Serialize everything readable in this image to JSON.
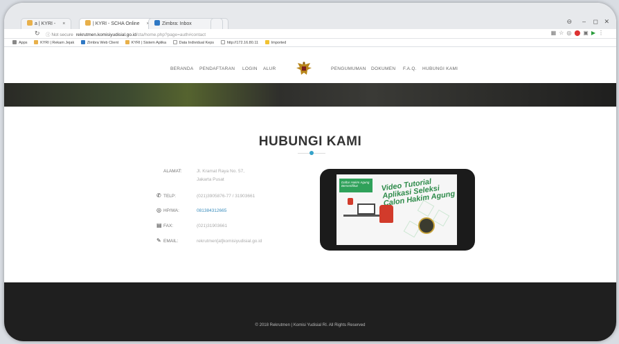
{
  "browser": {
    "tabs": [
      {
        "label": "a | KYRI -",
        "color": "#e8b04a"
      },
      {
        "label": "| KYRI - SCHA Online",
        "color": "#e8b04a"
      },
      {
        "label": "Zimbra: Inbox",
        "color": "#2f78c4"
      }
    ],
    "url_prefix": "Not secure",
    "url_host": "rekrutmen.komisiyudisial.go.id",
    "url_path": "/cta/home.php?page=auth#contact",
    "bookmarks": [
      {
        "label": "Apps",
        "color": "#888888"
      },
      {
        "label": "KYRI | Rekam Jejak",
        "color": "#e8b04a"
      },
      {
        "label": "Zimbra Web Client",
        "color": "#2f78c4"
      },
      {
        "label": "KYRI | Sistem Aplika",
        "color": "#e8b04a"
      },
      {
        "label": "Data Individual Keps",
        "color": "#999999"
      },
      {
        "label": "http://172.16.80.11",
        "color": "#999999"
      },
      {
        "label": "Imported",
        "color": "#f1c232"
      }
    ]
  },
  "nav": {
    "left": [
      "BERANDA",
      "PENDAFTARAN",
      "LOGIN",
      "ALUR"
    ],
    "right": [
      "PENGUMUMAN",
      "DOKUMEN",
      "F.A.Q.",
      "HUBUNGI KAMI"
    ]
  },
  "contact": {
    "title": "HUBUNGI KAMI",
    "alamat_label": "ALAMAT:",
    "alamat_line1": "Jl. Kramat Raya No. 57,",
    "alamat_line2": "Jakarta Pusat",
    "telp_label": "TELP:",
    "telp_value": "(021)3905876-77 / 31903661",
    "hp_label": "HP/WA:",
    "hp_value": "081384312665",
    "fax_label": "FAX:",
    "fax_value": "(021)31903661",
    "email_label": "EMAIL:",
    "email_value": "rekrutmen[at]komisiyudisial.go.id"
  },
  "video": {
    "banner": "Daftar Hakim Agung Bersertifikat",
    "title_line1": "Video Tutorial",
    "title_line2": "Aplikasi Seleksi",
    "title_line3": "Calon Hakim Agung"
  },
  "footer": {
    "text": "© 2018 Rekrutmen | Komisi Yudisial RI. All Rights Reserved"
  }
}
